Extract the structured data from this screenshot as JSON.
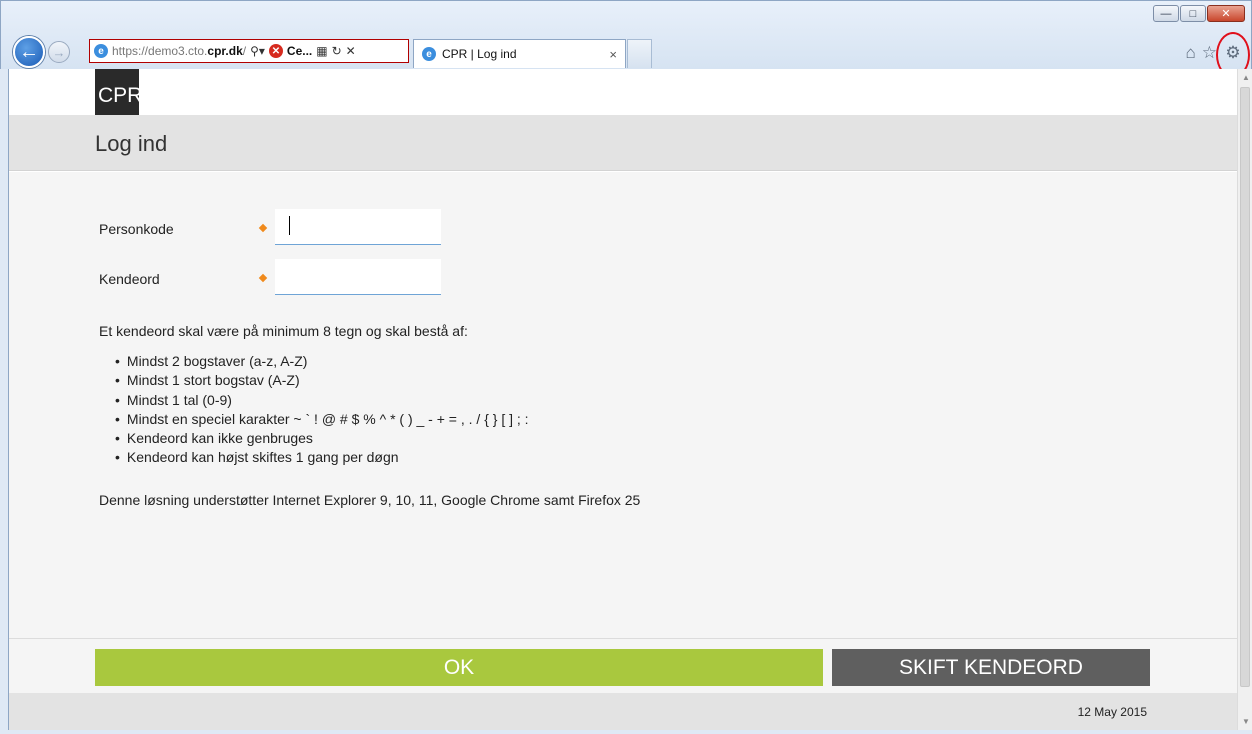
{
  "browser": {
    "address_url_dim": "https://demo3.cto.",
    "address_url_host": "cpr.dk",
    "address_url_tail": "/",
    "cert_label": "Ce...",
    "tab_title": "CPR | Log ind",
    "icons": [
      "back-arrow-icon",
      "forward-arrow-icon",
      "search-icon",
      "certificate-error-icon",
      "compatibility-icon",
      "refresh-icon",
      "stop-icon",
      "home-icon",
      "favorites-star-icon",
      "gear-icon"
    ]
  },
  "site": {
    "logo": "CPR",
    "page_title": "Log ind"
  },
  "form": {
    "personkode_label": "Personkode",
    "personkode_value": "",
    "kendeord_label": "Kendeord",
    "kendeord_value": ""
  },
  "rules": {
    "intro": "Et kendeord skal være på minimum 8 tegn og skal bestå af:",
    "items": [
      "Mindst 2 bogstaver (a-z, A-Z)",
      "Mindst 1 stort bogstav (A-Z)",
      "Mindst 1 tal (0-9)",
      "Mindst en speciel karakter ~ ` ! @ # $ % ^ * ( ) _ - + = , . / { } [ ] ; :",
      "Kendeord kan ikke genbruges",
      "Kendeord kan højst skiftes 1 gang per døgn"
    ],
    "support": "Denne løsning understøtter Internet Explorer 9, 10, 11, Google Chrome samt Firefox 25"
  },
  "actions": {
    "ok_label": "OK",
    "change_label": "SKIFT KENDEORD"
  },
  "footer": {
    "date": "12 May 2015"
  },
  "colors": {
    "ok_button": "#a9c83e",
    "change_button": "#5f5f5f",
    "required_marker": "#f08a1c",
    "annotation_ring": "#e0101b"
  }
}
